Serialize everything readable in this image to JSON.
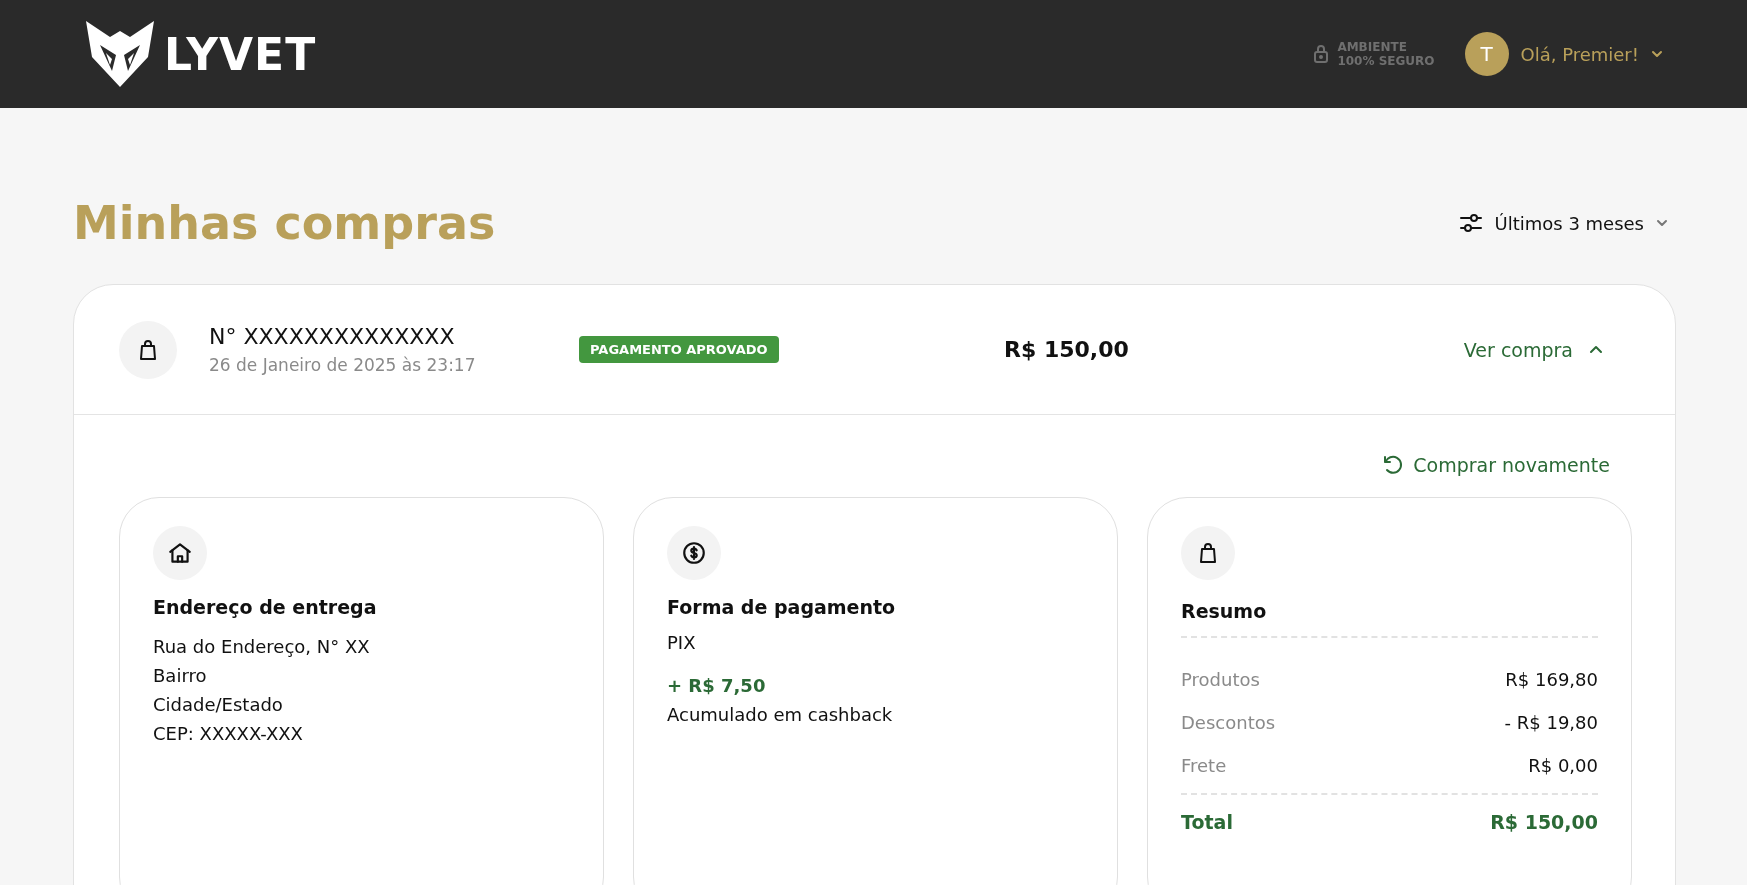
{
  "header": {
    "logo": "LYVET",
    "security": {
      "line1": "AMBIENTE",
      "line2": "100% SEGURO"
    },
    "user": {
      "initial": "T",
      "greeting": "Olá, Premier!"
    }
  },
  "page": {
    "title": "Minhas compras",
    "filter": "Últimos 3 meses"
  },
  "order": {
    "number": "N° XXXXXXXXXXXXXX",
    "date": "26 de Janeiro de 2025 às 23:17",
    "status": {
      "kind": "approved",
      "label": "PAGAMENTO APROVADO"
    },
    "price": "R$ 150,00",
    "toggle": "Ver compra",
    "expanded": true,
    "reorder": "Comprar novamente",
    "cards": [
      {
        "kind": "address",
        "title": "Endereço de entrega",
        "lines": [
          "Rua do Endereço, N° XX",
          "Bairro",
          "Cidade/Estado",
          "CEP: XXXXX-XXX"
        ]
      },
      {
        "kind": "payment",
        "title": "Forma de pagamento",
        "method": "PIX",
        "cashback": "+ R$ 7,50",
        "cashback_note": "Acumulado em cashback"
      },
      {
        "kind": "summary",
        "title": "Resumo",
        "rows": [
          {
            "label": "Produtos",
            "value": "R$ 169,80"
          },
          {
            "label": "Descontos",
            "value": "- R$ 19,80"
          },
          {
            "label": "Frete",
            "value": "R$ 0,00"
          }
        ],
        "total": {
          "label": "Total",
          "value": "R$ 150,00"
        }
      }
    ]
  }
}
